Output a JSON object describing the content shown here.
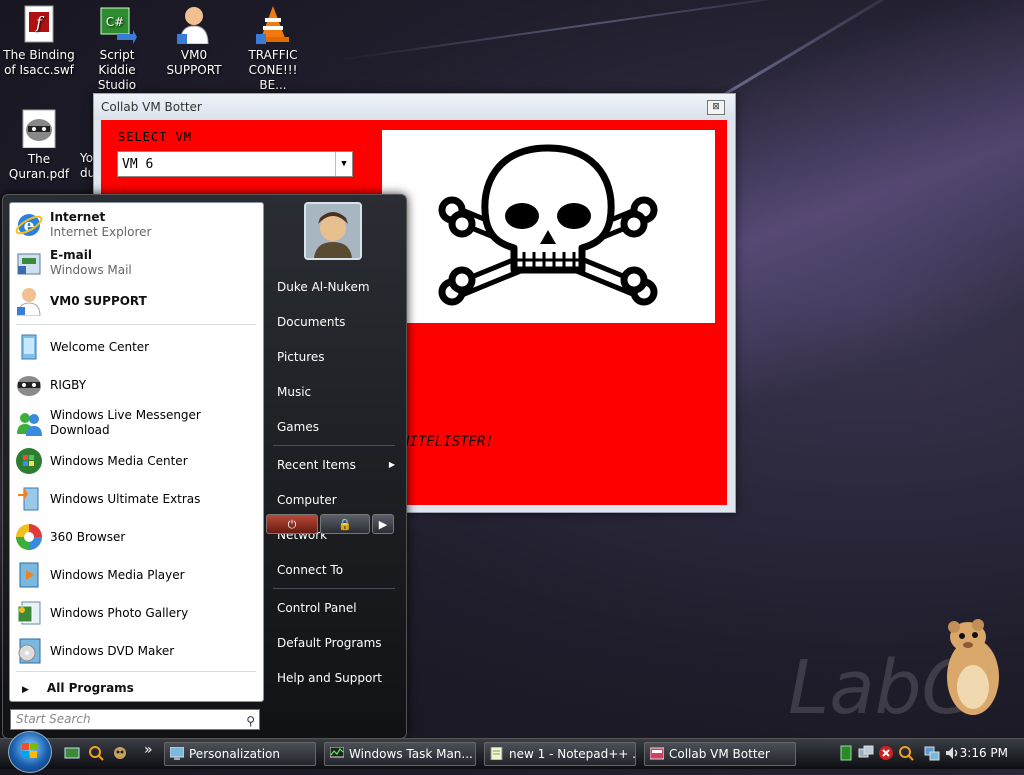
{
  "desktop": {
    "icons": [
      {
        "label": "The Binding of Isacc.swf",
        "line1": "The Binding",
        "line2": "of Isacc.swf"
      },
      {
        "label": "Script Kiddie Studio",
        "line1": "Script Kiddie",
        "line2": "Studio"
      },
      {
        "label": "VM0 SUPPORT",
        "line1": "VM0",
        "line2": "SUPPORT"
      },
      {
        "label": "TRAFFIC CONE!!! BE...",
        "line1": "TRAFFIC",
        "line2": "CONE!!! BE..."
      },
      {
        "label": "The Quran.pdf",
        "line1": "The",
        "line2": "Quran.pdf"
      },
      {
        "label": "Yo du",
        "line1": "Yo",
        "line2": "du"
      }
    ],
    "watermark": "LabC"
  },
  "window": {
    "title": "Collab VM Botter",
    "close_symbol": "⊠",
    "select_label": "SELECT VM",
    "selected_vm": "VM 6",
    "whitelister_text": "HITELISTER!",
    "background_color": "#ff0000"
  },
  "start_menu": {
    "pinned": [
      {
        "title": "Internet",
        "subtitle": "Internet Explorer",
        "icon": "internet-explorer-icon"
      },
      {
        "title": "E-mail",
        "subtitle": "Windows Mail",
        "icon": "windows-mail-icon"
      }
    ],
    "pinned_single": {
      "title": "VM0 SUPPORT",
      "icon": "vm0-support-icon"
    },
    "recent": [
      {
        "label": "Welcome Center",
        "icon": "welcome-center-icon"
      },
      {
        "label": "RIGBY",
        "icon": "rigby-icon"
      },
      {
        "label": "Windows Live Messenger Download",
        "icon": "messenger-icon"
      },
      {
        "label": "Windows Media Center",
        "icon": "media-center-icon"
      },
      {
        "label": "Windows Ultimate Extras",
        "icon": "ultimate-extras-icon"
      },
      {
        "label": "360 Browser",
        "icon": "360-browser-icon"
      },
      {
        "label": "Windows Media Player",
        "icon": "media-player-icon"
      },
      {
        "label": "Windows Photo Gallery",
        "icon": "photo-gallery-icon"
      },
      {
        "label": "Windows DVD Maker",
        "icon": "dvd-maker-icon"
      }
    ],
    "all_programs": "All Programs",
    "search_placeholder": "Start Search",
    "right_items": {
      "user": "Duke Al-Nukem",
      "documents": "Documents",
      "pictures": "Pictures",
      "music": "Music",
      "games": "Games",
      "recent_items": "Recent Items",
      "computer": "Computer",
      "network": "Network",
      "connect_to": "Connect To",
      "control_panel": "Control Panel",
      "default_programs": "Default Programs",
      "help": "Help and Support"
    }
  },
  "taskbar": {
    "buttons": [
      {
        "label": "Personalization",
        "icon": "personalization-icon"
      },
      {
        "label": "Windows Task Man...",
        "icon": "task-manager-icon"
      },
      {
        "label": "new 1 - Notepad++ ...",
        "icon": "notepadpp-icon"
      },
      {
        "label": "Collab VM Botter",
        "icon": "collab-vm-icon"
      }
    ],
    "overflow_symbol": "»",
    "clock": "3:16 PM"
  }
}
